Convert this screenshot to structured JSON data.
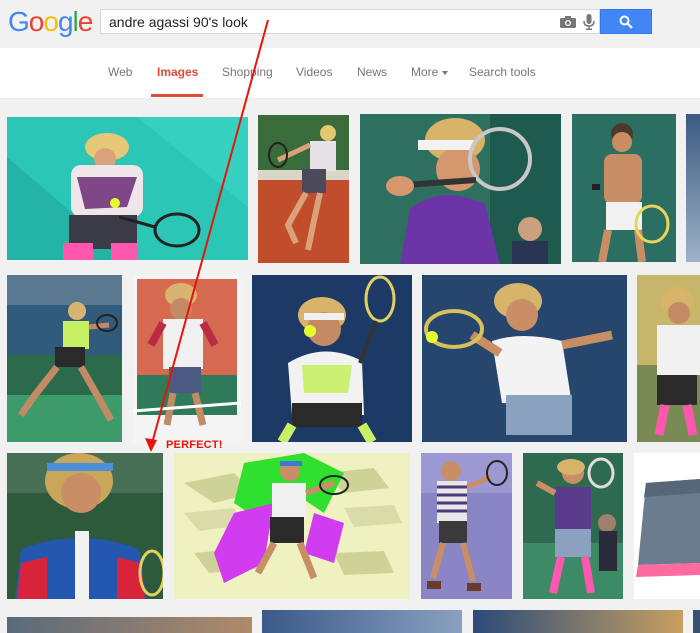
{
  "logo": {
    "letters": [
      "G",
      "o",
      "o",
      "g",
      "l",
      "e"
    ],
    "colors": [
      "#4285f4",
      "#ea4335",
      "#fbbc05",
      "#4285f4",
      "#34a853",
      "#ea4335"
    ]
  },
  "search": {
    "query": "andre agassi 90's look"
  },
  "tabs": {
    "web": "Web",
    "images": "Images",
    "shopping": "Shopping",
    "videos": "Videos",
    "news": "News",
    "more": "More",
    "search_tools": "Search tools"
  },
  "annotation": {
    "label": "PERFECT!",
    "color": "#e8140c"
  },
  "colors": {
    "accent": "#dd4b39",
    "search_button": "#4285f4"
  }
}
